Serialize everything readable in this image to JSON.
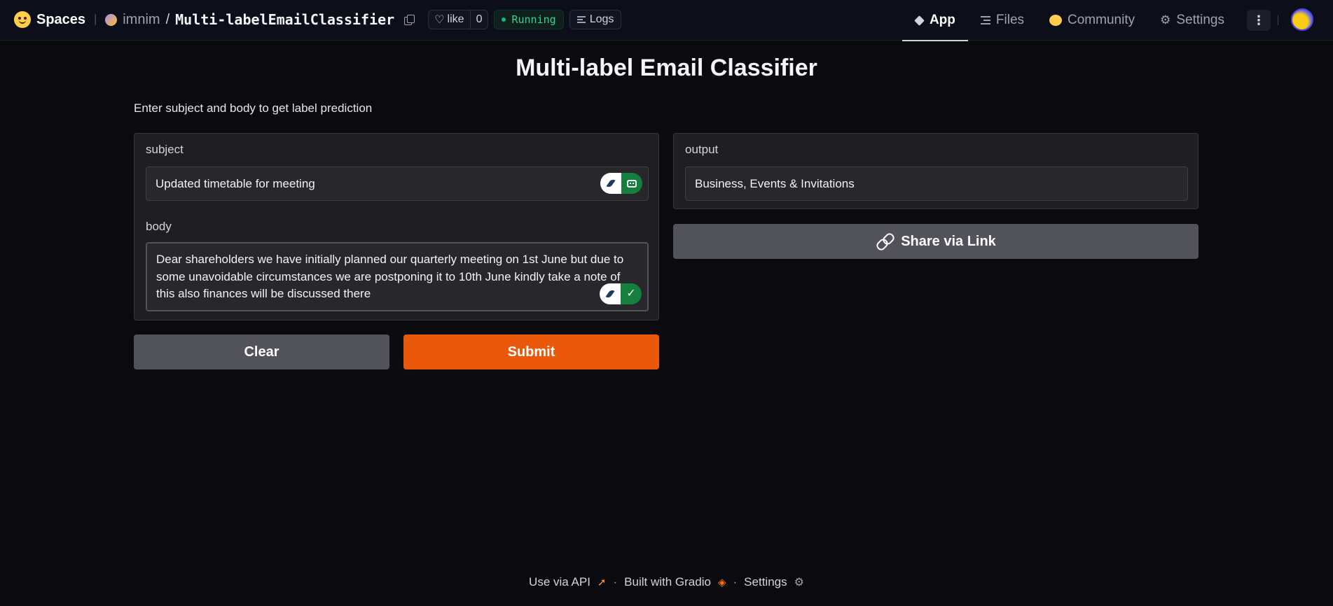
{
  "topbar": {
    "spaces_label": "Spaces",
    "owner": "imnim",
    "slash": "/",
    "repo": "Multi-labelEmailClassifier",
    "like_label": "like",
    "like_count": "0",
    "status": "Running",
    "logs_label": "Logs",
    "tabs": [
      {
        "label": "App",
        "active": true
      },
      {
        "label": "Files",
        "active": false
      },
      {
        "label": "Community",
        "active": false
      },
      {
        "label": "Settings",
        "active": false
      }
    ],
    "more_label": "⋮"
  },
  "app": {
    "title": "Multi-label Email Classifier",
    "description": "Enter subject and body to get label prediction",
    "subject": {
      "label": "subject",
      "value": "Updated timetable for meeting"
    },
    "body": {
      "label": "body",
      "value": "Dear shareholders we have initially planned our quarterly meeting on 1st June but due to some unavoidable circumstances we are postponing it to 10th June kindly take a note of this also finances will be discussed there"
    },
    "output": {
      "label": "output",
      "value": "Business, Events & Invitations"
    },
    "buttons": {
      "clear": "Clear",
      "submit": "Submit",
      "share": "Share via Link"
    },
    "check_mark": "✓"
  },
  "footer": {
    "api": "Use via API",
    "built": "Built with Gradio",
    "settings": "Settings",
    "separator": "·"
  },
  "colors": {
    "accent_submit": "#ea580c",
    "status_running": "#10b981",
    "background": "#0b0b0f"
  },
  "icons": [
    "hugging-face-logo",
    "copy-icon",
    "heart-icon",
    "logs-icon",
    "app-icon",
    "files-icon",
    "community-icon",
    "gear-icon",
    "more-icon",
    "link-icon",
    "feather-icon",
    "robot-icon",
    "check-icon",
    "rocket-icon",
    "gradio-icon"
  ]
}
